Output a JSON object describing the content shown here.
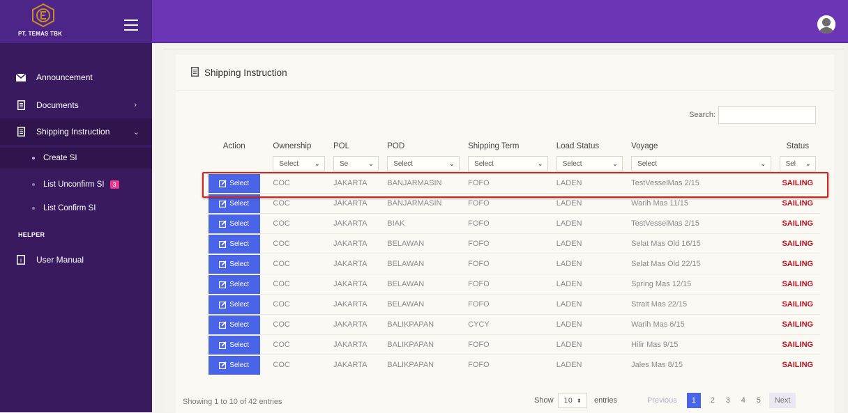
{
  "brand": {
    "name": "PT. TEMAS TBK"
  },
  "sidebar": {
    "items": [
      {
        "label": "Announcement"
      },
      {
        "label": "Documents"
      },
      {
        "label": "Shipping Instruction"
      }
    ],
    "subitems": [
      {
        "label": "Create SI"
      },
      {
        "label": "List Unconfirm SI",
        "badge": "3"
      },
      {
        "label": "List Confirm SI"
      }
    ],
    "helper_label": "HELPER",
    "helper_items": [
      {
        "label": "User Manual"
      }
    ]
  },
  "page": {
    "title": "Shipping Instruction"
  },
  "search": {
    "label": "Search:",
    "value": ""
  },
  "table": {
    "columns": [
      "Action",
      "Ownership",
      "POL",
      "POD",
      "Shipping Term",
      "Load Status",
      "Voyage",
      "Status"
    ],
    "filters": [
      "Select",
      "Se",
      "Select",
      "Select",
      "Select",
      "Select",
      "Sel"
    ],
    "action_label": "Select",
    "rows": [
      {
        "ownership": "COC",
        "pol": "JAKARTA",
        "pod": "BANJARMASIN",
        "term": "FOFO",
        "load": "LADEN",
        "voyage": "TestVesselMas 2/15",
        "status": "SAILING"
      },
      {
        "ownership": "COC",
        "pol": "JAKARTA",
        "pod": "BANJARMASIN",
        "term": "FOFO",
        "load": "LADEN",
        "voyage": "Warih Mas 11/15",
        "status": "SAILING"
      },
      {
        "ownership": "COC",
        "pol": "JAKARTA",
        "pod": "BIAK",
        "term": "FOFO",
        "load": "LADEN",
        "voyage": "TestVesselMas 2/15",
        "status": "SAILING"
      },
      {
        "ownership": "COC",
        "pol": "JAKARTA",
        "pod": "BELAWAN",
        "term": "FOFO",
        "load": "LADEN",
        "voyage": "Selat Mas Old 16/15",
        "status": "SAILING"
      },
      {
        "ownership": "COC",
        "pol": "JAKARTA",
        "pod": "BELAWAN",
        "term": "FOFO",
        "load": "LADEN",
        "voyage": "Selat Mas Old 22/15",
        "status": "SAILING"
      },
      {
        "ownership": "COC",
        "pol": "JAKARTA",
        "pod": "BELAWAN",
        "term": "FOFO",
        "load": "LADEN",
        "voyage": "Spring Mas 12/15",
        "status": "SAILING"
      },
      {
        "ownership": "COC",
        "pol": "JAKARTA",
        "pod": "BELAWAN",
        "term": "FOFO",
        "load": "LADEN",
        "voyage": "Strait Mas 22/15",
        "status": "SAILING"
      },
      {
        "ownership": "COC",
        "pol": "JAKARTA",
        "pod": "BALIKPAPAN",
        "term": "CYCY",
        "load": "LADEN",
        "voyage": "Warih Mas 6/15",
        "status": "SAILING"
      },
      {
        "ownership": "COC",
        "pol": "JAKARTA",
        "pod": "BALIKPAPAN",
        "term": "FOFO",
        "load": "LADEN",
        "voyage": "Hilir Mas 9/15",
        "status": "SAILING"
      },
      {
        "ownership": "COC",
        "pol": "JAKARTA",
        "pod": "BALIKPAPAN",
        "term": "FOFO",
        "load": "LADEN",
        "voyage": "Jales Mas 8/15",
        "status": "SAILING"
      }
    ]
  },
  "footer": {
    "info": "Showing 1 to 10 of 42 entries",
    "show_label": "Show",
    "page_size": "10",
    "entries_label": "entries",
    "pagination": {
      "previous": "Previous",
      "pages": [
        "1",
        "2",
        "3",
        "4",
        "5"
      ],
      "next": "Next"
    }
  },
  "colors": {
    "topbar": "#6a36b5",
    "sidebar": "#3a1a5f",
    "accent": "#4a64e8",
    "status": "#c0101f",
    "highlight": "#d8221a"
  }
}
